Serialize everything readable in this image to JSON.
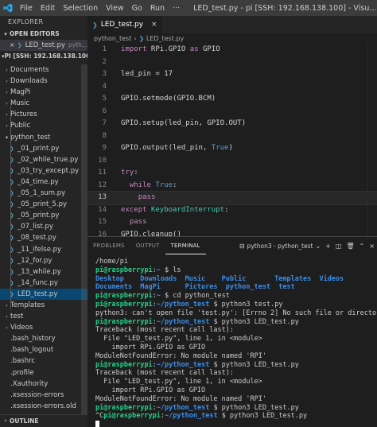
{
  "titlebar": {
    "menu": [
      "File",
      "Edit",
      "Selection",
      "View",
      "Go",
      "Run",
      "···"
    ],
    "title": "LED_test.py - pi [SSH: 192.168.138.100] - Visu..."
  },
  "sidebar": {
    "header": "EXPLORER",
    "open_editors_label": "OPEN EDITORS",
    "open_editor": {
      "name": "LED_test.py",
      "folder": "pyth..."
    },
    "workspace_label": "PI [SSH: 192.168.138.100]",
    "items": [
      {
        "label": "Documents",
        "type": "folder"
      },
      {
        "label": "Downloads",
        "type": "folder"
      },
      {
        "label": "MagPi",
        "type": "folder"
      },
      {
        "label": "Music",
        "type": "folder"
      },
      {
        "label": "Pictures",
        "type": "folder"
      },
      {
        "label": "Public",
        "type": "folder"
      },
      {
        "label": "python_test",
        "type": "folder-open"
      },
      {
        "label": "_01_print.py",
        "type": "file"
      },
      {
        "label": "_02_while_true.py",
        "type": "file"
      },
      {
        "label": "_03_try_except.py",
        "type": "file"
      },
      {
        "label": "_04_time.py",
        "type": "file"
      },
      {
        "label": "_05_1_sum.py",
        "type": "file"
      },
      {
        "label": "_05_print_5.py",
        "type": "file"
      },
      {
        "label": "_05_print.py",
        "type": "file"
      },
      {
        "label": "_07_list.py",
        "type": "file"
      },
      {
        "label": "_08_test.py",
        "type": "file"
      },
      {
        "label": "_11_ifelse.py",
        "type": "file"
      },
      {
        "label": "_12_for.py",
        "type": "file"
      },
      {
        "label": "_13_while.py",
        "type": "file"
      },
      {
        "label": "_14_func.py",
        "type": "file"
      },
      {
        "label": "LED_test.py",
        "type": "file",
        "selected": true
      },
      {
        "label": "Templates",
        "type": "folder"
      },
      {
        "label": "test",
        "type": "folder"
      },
      {
        "label": "Videos",
        "type": "folder"
      },
      {
        "label": ".bash_history",
        "type": "plain"
      },
      {
        "label": ".bash_logout",
        "type": "plain"
      },
      {
        "label": ".bashrc",
        "type": "plain"
      },
      {
        "label": ".profile",
        "type": "plain"
      },
      {
        "label": ".Xauthority",
        "type": "plain"
      },
      {
        "label": ".xsession-errors",
        "type": "plain"
      },
      {
        "label": ".xsession-errors.old",
        "type": "plain"
      }
    ],
    "outline_label": "OUTLINE"
  },
  "editor": {
    "tab_label": "LED_test.py",
    "breadcrumb": [
      "python_test",
      "LED_test.py"
    ],
    "current_line": 13,
    "lines": [
      {
        "n": "1",
        "tokens": [
          {
            "t": "import",
            "c": "kw"
          },
          {
            "t": " RPi.GPIO ",
            "c": "pl"
          },
          {
            "t": "as",
            "c": "kw"
          },
          {
            "t": " GPIO",
            "c": "pl"
          }
        ]
      },
      {
        "n": "2",
        "tokens": []
      },
      {
        "n": "3",
        "tokens": [
          {
            "t": "led_pin",
            "c": "pl"
          },
          {
            "t": " = ",
            "c": "pl"
          },
          {
            "t": "17",
            "c": "pl"
          }
        ]
      },
      {
        "n": "4",
        "tokens": []
      },
      {
        "n": "5",
        "tokens": [
          {
            "t": "GPIO.setmode(GPIO.BCM)",
            "c": "pl"
          }
        ]
      },
      {
        "n": "6",
        "tokens": []
      },
      {
        "n": "7",
        "tokens": [
          {
            "t": "GPIO.setup(led_pin, GPIO.OUT)",
            "c": "pl"
          }
        ]
      },
      {
        "n": "8",
        "tokens": []
      },
      {
        "n": "9",
        "tokens": [
          {
            "t": "GPIO.output(led_pin, ",
            "c": "pl"
          },
          {
            "t": "True",
            "c": "bt"
          },
          {
            "t": ")",
            "c": "pl"
          }
        ]
      },
      {
        "n": "10",
        "tokens": []
      },
      {
        "n": "11",
        "tokens": [
          {
            "t": "try",
            "c": "kw"
          },
          {
            "t": ":",
            "c": "pl"
          }
        ]
      },
      {
        "n": "12",
        "tokens": [
          {
            "t": "  ",
            "c": "pl"
          },
          {
            "t": "while",
            "c": "kw"
          },
          {
            "t": " ",
            "c": "pl"
          },
          {
            "t": "True",
            "c": "bt"
          },
          {
            "t": ":",
            "c": "pl"
          }
        ]
      },
      {
        "n": "13",
        "tokens": [
          {
            "t": "    ",
            "c": "pl"
          },
          {
            "t": "pass",
            "c": "kw"
          }
        ]
      },
      {
        "n": "14",
        "tokens": [
          {
            "t": "except",
            "c": "kw"
          },
          {
            "t": " ",
            "c": "pl"
          },
          {
            "t": "KeyboardInterrupt",
            "c": "cls"
          },
          {
            "t": ":",
            "c": "pl"
          }
        ]
      },
      {
        "n": "15",
        "tokens": [
          {
            "t": "  ",
            "c": "pl"
          },
          {
            "t": "pass",
            "c": "kw"
          }
        ]
      },
      {
        "n": "16",
        "tokens": [
          {
            "t": "GPIO.cleanup()",
            "c": "pl"
          }
        ]
      }
    ]
  },
  "panel": {
    "tabs": [
      "PROBLEMS",
      "OUTPUT",
      "TERMINAL"
    ],
    "active_tab": "TERMINAL",
    "terminal_selector": "python3 - python_test",
    "terminal_lines": [
      [
        {
          "t": "/home/pi",
          "c": "w"
        }
      ],
      [
        {
          "t": "pi@raspberrypi",
          "c": "g"
        },
        {
          "t": ":",
          "c": "w"
        },
        {
          "t": "~ ",
          "c": "b"
        },
        {
          "t": "$ ls",
          "c": "w"
        }
      ],
      [
        {
          "t": "Desktop    Downloads  Music    Public       Templates  Videos",
          "c": "b"
        }
      ],
      [
        {
          "t": "Documents  MagPi      Pictures  python_test  test",
          "c": "b"
        }
      ],
      [
        {
          "t": "pi@raspberrypi",
          "c": "g"
        },
        {
          "t": ":",
          "c": "w"
        },
        {
          "t": "~ ",
          "c": "b"
        },
        {
          "t": "$ cd python_test",
          "c": "w"
        }
      ],
      [
        {
          "t": "pi@raspberrypi",
          "c": "g"
        },
        {
          "t": ":",
          "c": "w"
        },
        {
          "t": "~/python_test ",
          "c": "b"
        },
        {
          "t": "$ python3 test.py",
          "c": "w"
        }
      ],
      [
        {
          "t": "python3: can't open file 'test.py': [Errno 2] No such file or directory",
          "c": "w"
        }
      ],
      [
        {
          "t": "pi@raspberrypi",
          "c": "g"
        },
        {
          "t": ":",
          "c": "w"
        },
        {
          "t": "~/python_test ",
          "c": "b"
        },
        {
          "t": "$ python3 LED_test.py",
          "c": "w"
        }
      ],
      [
        {
          "t": "Traceback (most recent call last):",
          "c": "w"
        }
      ],
      [
        {
          "t": "  File \"LED_test.py\", line 1, in <module>",
          "c": "w"
        }
      ],
      [
        {
          "t": "    import RPi.GPIO as GPIO",
          "c": "w"
        }
      ],
      [
        {
          "t": "ModuleNotFoundError: No module named 'RPI'",
          "c": "w"
        }
      ],
      [
        {
          "t": "pi@raspberrypi",
          "c": "g"
        },
        {
          "t": ":",
          "c": "w"
        },
        {
          "t": "~/python_test ",
          "c": "b"
        },
        {
          "t": "$ python3 LED_test.py",
          "c": "w"
        }
      ],
      [
        {
          "t": "Traceback (most recent call last):",
          "c": "w"
        }
      ],
      [
        {
          "t": "  File \"LED_test.py\", line 1, in <module>",
          "c": "w"
        }
      ],
      [
        {
          "t": "    import RPi.GPIO as GPIO",
          "c": "w"
        }
      ],
      [
        {
          "t": "ModuleNotFoundError: No module named 'RPI'",
          "c": "w"
        }
      ],
      [
        {
          "t": "pi@raspberrypi",
          "c": "g"
        },
        {
          "t": ":",
          "c": "w"
        },
        {
          "t": "~/python_test ",
          "c": "b"
        },
        {
          "t": "$ python3 LED_test.py",
          "c": "w"
        }
      ],
      [
        {
          "t": "^C",
          "c": "w"
        },
        {
          "t": "pi@raspberrypi",
          "c": "g"
        },
        {
          "t": ":",
          "c": "w"
        },
        {
          "t": "~/python_test ",
          "c": "b"
        },
        {
          "t": "$ python3 LED_test.py",
          "c": "w"
        }
      ]
    ]
  },
  "colors": {
    "titlebar_bg": "#3c3c3c",
    "sidebar_bg": "#252526",
    "editor_bg": "#1e1e1e",
    "selection": "#094771",
    "prompt_user": "#23d18b",
    "prompt_path": "#3b8eea",
    "keyword": "#c586c0",
    "builtin": "#569cd6",
    "class": "#4ec9b0"
  }
}
